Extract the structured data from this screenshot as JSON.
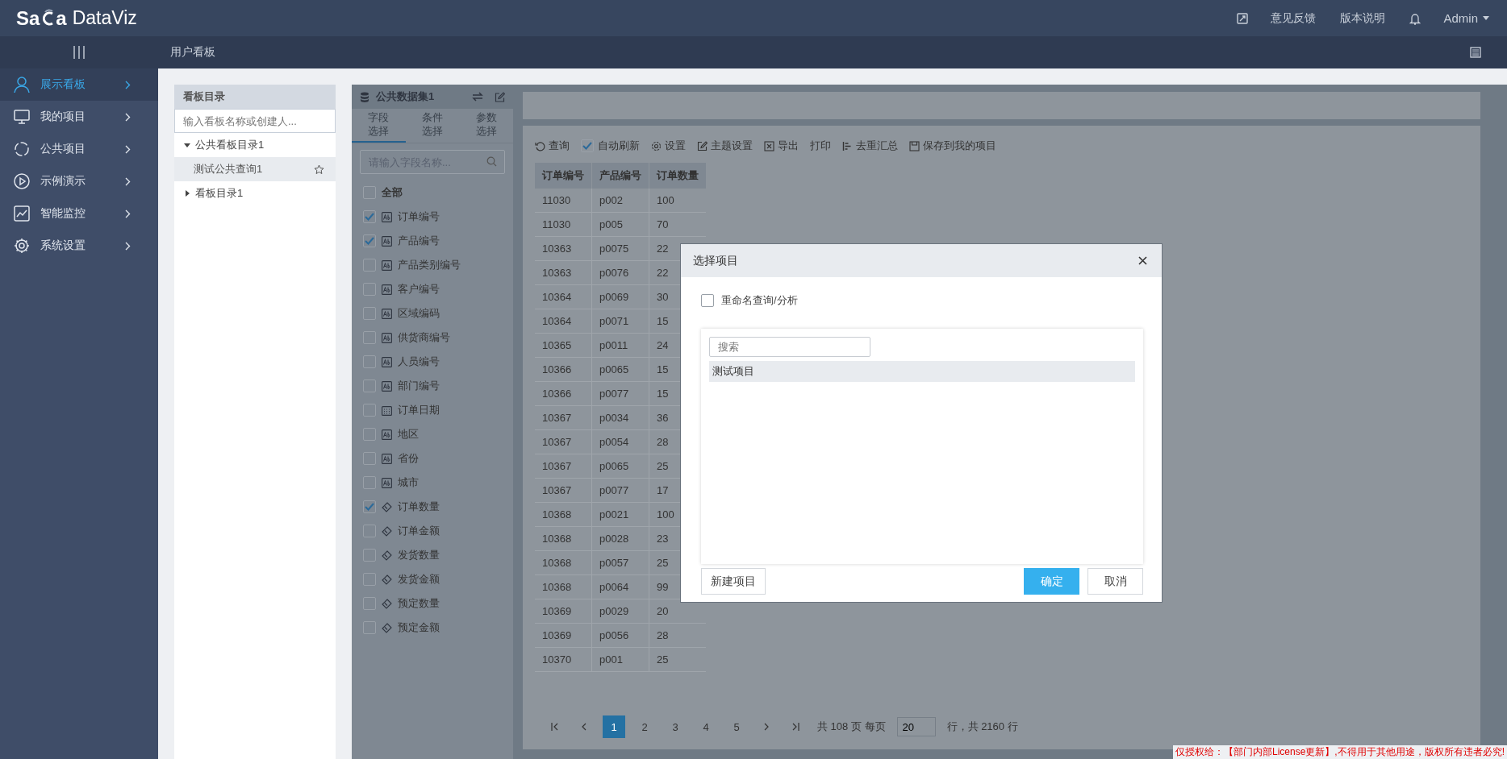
{
  "top_bar": {
    "logo": {
      "left": "Sa",
      "right": "a",
      "product": "DataViz"
    },
    "items": [
      {
        "kind": "fullscreen"
      },
      {
        "kind": "link",
        "label": "意见反馈"
      },
      {
        "kind": "link",
        "label": "版本说明"
      },
      {
        "kind": "bell"
      },
      {
        "kind": "user",
        "label": "Admin"
      }
    ]
  },
  "sub_bar": {
    "title": "用户看板"
  },
  "sidebar": {
    "items": [
      {
        "kind": "person",
        "label": "展示看板",
        "selected": true
      },
      {
        "kind": "monitor",
        "label": "我的项目",
        "selected": false
      },
      {
        "kind": "ring",
        "label": "公共项目",
        "selected": false
      },
      {
        "kind": "play",
        "label": "示例演示",
        "selected": false
      },
      {
        "kind": "chart",
        "label": "智能监控",
        "selected": false
      },
      {
        "kind": "gear",
        "label": "系统设置",
        "selected": false
      }
    ]
  },
  "board_panel": {
    "title": "看板目录",
    "search": {
      "placeholder": "输入看板名称或创建人..."
    },
    "tree": [
      {
        "label": "公共看板目录1",
        "expanded": true,
        "children": [
          {
            "label": "测试公共查询1",
            "selected": true
          }
        ]
      },
      {
        "label": "看板目录1",
        "expanded": false
      }
    ]
  },
  "dataset_panel": {
    "title": "公共数据集1",
    "tabs": [
      {
        "label": "字段选择",
        "selected": true
      },
      {
        "label": "条件选择",
        "selected": false
      },
      {
        "label": "参数选择",
        "selected": false
      }
    ],
    "search": {
      "placeholder": "请输入字段名称..."
    },
    "all": {
      "label": "全部",
      "checked": false
    },
    "fields": [
      {
        "kind": "text",
        "label": "订单编号",
        "checked": true
      },
      {
        "kind": "text",
        "label": "产品编号",
        "checked": true
      },
      {
        "kind": "text",
        "label": "产品类别编号",
        "checked": false
      },
      {
        "kind": "text",
        "label": "客户编号",
        "checked": false
      },
      {
        "kind": "text",
        "label": "区域编码",
        "checked": false
      },
      {
        "kind": "text",
        "label": "供货商编号",
        "checked": false
      },
      {
        "kind": "text",
        "label": "人员编号",
        "checked": false
      },
      {
        "kind": "text",
        "label": "部门编号",
        "checked": false
      },
      {
        "kind": "date",
        "label": "订单日期",
        "checked": false
      },
      {
        "kind": "text",
        "label": "地区",
        "checked": false
      },
      {
        "kind": "text",
        "label": "省份",
        "checked": false
      },
      {
        "kind": "text",
        "label": "城市",
        "checked": false
      },
      {
        "kind": "number",
        "label": "订单数量",
        "checked": true
      },
      {
        "kind": "number",
        "label": "订单金额",
        "checked": false
      },
      {
        "kind": "number",
        "label": "发货数量",
        "checked": false
      },
      {
        "kind": "number",
        "label": "发货金额",
        "checked": false
      },
      {
        "kind": "number",
        "label": "预定数量",
        "checked": false
      },
      {
        "kind": "number",
        "label": "预定金额",
        "checked": false
      }
    ]
  },
  "toolbar": [
    {
      "kind": "refresh",
      "label": "查询"
    },
    {
      "kind": "checkbox",
      "label": "自动刷新",
      "checked": true
    },
    {
      "kind": "gear",
      "label": "设置"
    },
    {
      "kind": "edit",
      "label": "主题设置"
    },
    {
      "kind": "export",
      "label": "导出"
    },
    {
      "kind": "plain",
      "label": "打印"
    },
    {
      "kind": "dedup",
      "label": "去重汇总"
    },
    {
      "kind": "save",
      "label": "保存到我的项目"
    }
  ],
  "table": {
    "columns": [
      "订单编号",
      "产品编号",
      "订单数量"
    ],
    "rows": [
      [
        "11030",
        "p002",
        "100"
      ],
      [
        "11030",
        "p005",
        "70"
      ],
      [
        "10363",
        "p0075",
        "22"
      ],
      [
        "10363",
        "p0076",
        "22"
      ],
      [
        "10364",
        "p0069",
        "30"
      ],
      [
        "10364",
        "p0071",
        "15"
      ],
      [
        "10365",
        "p0011",
        "24"
      ],
      [
        "10366",
        "p0065",
        "15"
      ],
      [
        "10366",
        "p0077",
        "15"
      ],
      [
        "10367",
        "p0034",
        "36"
      ],
      [
        "10367",
        "p0054",
        "28"
      ],
      [
        "10367",
        "p0065",
        "25"
      ],
      [
        "10367",
        "p0077",
        "17"
      ],
      [
        "10368",
        "p0021",
        "100"
      ],
      [
        "10368",
        "p0028",
        "23"
      ],
      [
        "10368",
        "p0057",
        "25"
      ],
      [
        "10368",
        "p0064",
        "99"
      ],
      [
        "10369",
        "p0029",
        "20"
      ],
      [
        "10369",
        "p0056",
        "28"
      ],
      [
        "10370",
        "p001",
        "25"
      ]
    ]
  },
  "pagination": {
    "pages": [
      {
        "label": "1",
        "selected": true
      },
      {
        "label": "2",
        "selected": false
      },
      {
        "label": "3",
        "selected": false
      },
      {
        "label": "4",
        "selected": false
      },
      {
        "label": "5",
        "selected": false
      }
    ],
    "total_pages": "共 108 页 每页",
    "page_size": "20",
    "total_rows": "行，共 2160 行"
  },
  "dialog": {
    "title": "选择项目",
    "rename": {
      "label": "重命名查询/分析",
      "checked": false
    },
    "search": {
      "placeholder": "搜索"
    },
    "items": [
      {
        "label": "测试项目",
        "selected": true
      }
    ],
    "buttons": [
      {
        "kind": "secondary",
        "label": "新建项目"
      },
      {
        "kind": "primary",
        "label": "确定"
      },
      {
        "kind": "secondary",
        "label": "取消"
      }
    ]
  },
  "license_notice": "仅授权给：【部门内部License更新】,不得用于其他用途，版权所有违者必究!"
}
